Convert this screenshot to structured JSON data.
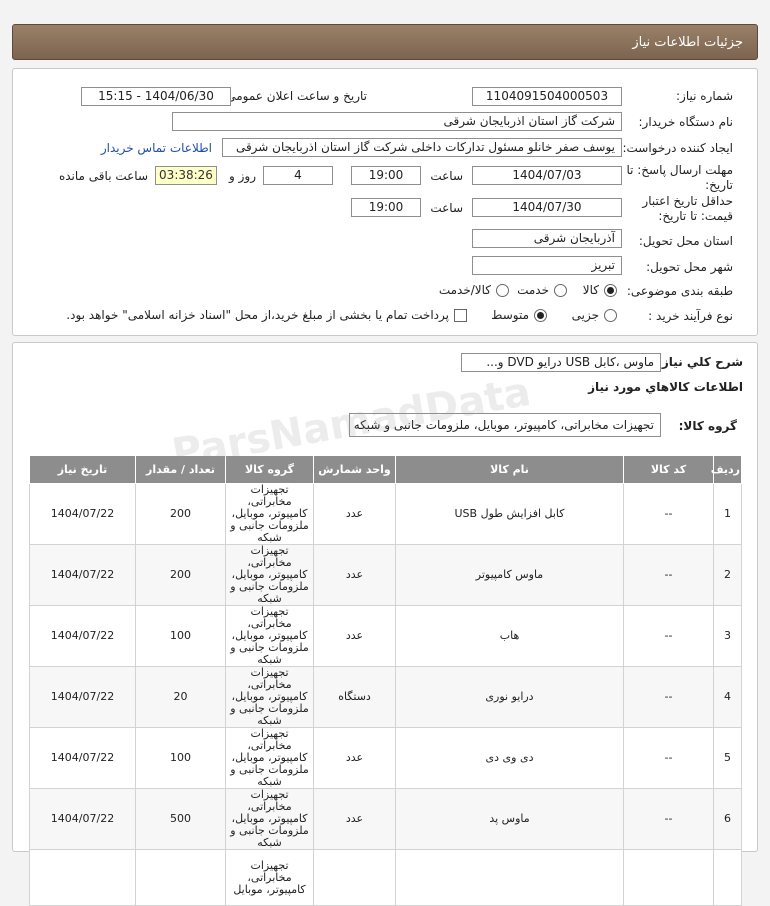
{
  "header": {
    "title": "جزئیات اطلاعات نیاز"
  },
  "info": {
    "need_number_label": "شماره نیاز:",
    "need_number": "1104091504000503",
    "announce_label": "تاریخ و ساعت اعلان عمومی:",
    "announce_value": "1404/06/30 - 15:15",
    "buyer_label": "نام دستگاه خریدار:",
    "buyer_value": "شرکت گاز استان اذربایجان شرقی",
    "creator_label": "ایجاد کننده درخواست:",
    "creator_value": "یوسف صفر خانلو  مسئول تدارکات داخلی  شرکت گاز استان اذربایجان شرقی",
    "contact_link": "اطلاعات تماس خریدار",
    "deadline_label_1": "مهلت ارسال پاسخ: تا",
    "deadline_label_2": "تاریخ:",
    "deadline_date": "1404/07/03",
    "time_label": "ساعت",
    "deadline_time": "19:00",
    "days": "4",
    "days_label": "روز و",
    "remaining": "03:38:26",
    "remaining_label": "ساعت باقی مانده",
    "validity_label_1": "حداقل تاریخ اعتبار",
    "validity_label_2": "قیمت: تا تاریخ:",
    "validity_date": "1404/07/30",
    "validity_time": "19:00",
    "province_label": "استان محل تحویل:",
    "province_value": "آذربایجان شرقی",
    "city_label": "شهر محل تحویل:",
    "city_value": "تبریز",
    "category_label": "طبقه بندی موضوعی:",
    "category_options": [
      "کالا",
      "خدمت",
      "کالا/خدمت"
    ],
    "purchase_label": "نوع فرآیند خرید :",
    "purchase_options": [
      "جزیی",
      "متوسط"
    ],
    "payment_note": "پرداخت تمام یا بخشی از مبلغ خرید،از محل \"اسناد خزانه اسلامی\" خواهد بود."
  },
  "summary": {
    "desc_label": "شرح کلي نياز:",
    "desc_value": "ماوس ،کابل USB درایو DVD و...",
    "items_heading": "اطلاعات کالاهاي مورد نياز",
    "group_label": "گروه کالا:",
    "group_value": "تجهیزات مخابراتی، کامپیوتر، موبایل، ملزومات جانبی و شبکه"
  },
  "table": {
    "headers": [
      "ردیف",
      "کد کالا",
      "نام کالا",
      "واحد شمارش",
      "گروه کالا",
      "تعداد / مقدار",
      "تاریخ نیاز"
    ],
    "rows": [
      {
        "idx": "1",
        "code": "--",
        "name": "کابل افزایش طول USB",
        "unit": "عدد",
        "group": "تجهیزات مخابراتی، کامپیوتر، موبایل، ملزومات جانبی و شبکه",
        "qty": "200",
        "date": "1404/07/22"
      },
      {
        "idx": "2",
        "code": "--",
        "name": "ماوس کامپیوتر",
        "unit": "عدد",
        "group": "تجهیزات مخابراتی، کامپیوتر، موبایل، ملزومات جانبی و شبکه",
        "qty": "200",
        "date": "1404/07/22"
      },
      {
        "idx": "3",
        "code": "--",
        "name": "هاب",
        "unit": "عدد",
        "group": "تجهیزات مخابراتی، کامپیوتر، موبایل، ملزومات جانبی و شبکه",
        "qty": "100",
        "date": "1404/07/22"
      },
      {
        "idx": "4",
        "code": "--",
        "name": "درایو نوری",
        "unit": "دستگاه",
        "group": "تجهیزات مخابراتی، کامپیوتر، موبایل، ملزومات جانبی و شبکه",
        "qty": "20",
        "date": "1404/07/22"
      },
      {
        "idx": "5",
        "code": "--",
        "name": "دی وی دی",
        "unit": "عدد",
        "group": "تجهیزات مخابراتی، کامپیوتر، موبایل، ملزومات جانبی و شبکه",
        "qty": "100",
        "date": "1404/07/22"
      },
      {
        "idx": "6",
        "code": "--",
        "name": "ماوس پد",
        "unit": "عدد",
        "group": "تجهیزات مخابراتی، کامپیوتر، موبایل، ملزومات جانبی و شبکه",
        "qty": "500",
        "date": "1404/07/22"
      },
      {
        "idx": "",
        "code": "",
        "name": "",
        "unit": "",
        "group": "تجهیزات مخابراتی، کامپیوتر، موبایل",
        "qty": "",
        "date": ""
      }
    ]
  },
  "watermark": "ParsNamadData"
}
